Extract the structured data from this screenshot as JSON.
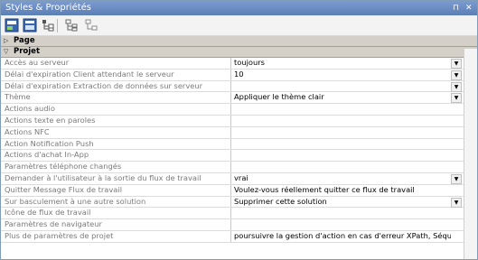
{
  "panel": {
    "title": "Styles & Propriétés",
    "pin_glyph": "⊓",
    "close_glyph": "✕"
  },
  "toolbar": {
    "icons": [
      "style-icon",
      "properties-icon",
      "tree-icon",
      "expand-icon",
      "collapse-icon"
    ]
  },
  "groups": {
    "page": "Page",
    "projet": "Projet"
  },
  "rows": [
    {
      "name": "Accès au serveur",
      "value": "toujours",
      "control": "dropdown"
    },
    {
      "name": "Délai d'expiration Client attendant le serveur",
      "value": "10",
      "control": "dropdown"
    },
    {
      "name": "Délai d'expiration Extraction de données sur serveur",
      "value": "",
      "control": "dropdown"
    },
    {
      "name": "Thème",
      "value": "Appliquer le thème clair",
      "control": "dropdown"
    },
    {
      "name": "Actions audio",
      "value": "",
      "control": "dialog"
    },
    {
      "name": "Actions texte en paroles",
      "value": "",
      "control": "dialog"
    },
    {
      "name": "Actions NFC",
      "value": "",
      "control": "dialog"
    },
    {
      "name": "Action Notification Push",
      "value": "",
      "control": "dialog"
    },
    {
      "name": "Actions d'achat In-App",
      "value": "",
      "control": "dialog"
    },
    {
      "name": "Paramètres téléphone changés",
      "value": "",
      "control": "dialog"
    },
    {
      "name": "Demander à l'utilisateur à la sortie du flux de travail",
      "value": "vrai",
      "control": "dropdown"
    },
    {
      "name": "Quitter Message Flux de travail",
      "value": "Voulez-vous réellement quitter ce flux de travail",
      "control": "none"
    },
    {
      "name": "Sur basculement à une autre solution",
      "value": "Supprimer cette solution",
      "control": "dropdown"
    },
    {
      "name": "Icône de flux de travail",
      "value": "",
      "control": "dialog"
    },
    {
      "name": "Paramètres de navigateur",
      "value": "",
      "control": "dialog"
    },
    {
      "name": "Plus de paramètres de projet",
      "value": "poursuivre la gestion d'action en cas d'erreur XPath, Séque...",
      "control": "dialog"
    }
  ],
  "glyphs": {
    "dropdown": "▼",
    "dialog": "..."
  }
}
